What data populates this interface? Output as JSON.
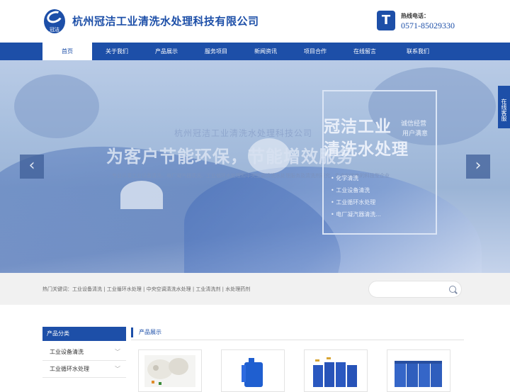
{
  "header": {
    "logo_text": "冠洁",
    "company_name": "杭州冠洁工业清洗水处理科技有限公司",
    "phone_icon": "T",
    "phone_label": "热线电话：",
    "phone_number": "0571-85029330"
  },
  "nav": {
    "items": [
      "首页",
      "关于我们",
      "产品展示",
      "服务项目",
      "新闻资讯",
      "项目合作",
      "在线留言",
      "联系我们"
    ],
    "active_index": 0
  },
  "hero": {
    "subtitle": "杭州冠洁工业清洗水处理科技公司",
    "title": "为客户节能环保，节能增效服务",
    "description": "专业从事工业设备清洗、电厂凝汽器清洗、工业循环水处理和中央空调清洗水处理服务及清洗剂研究、生产和销售的科技型企业",
    "box_title_line1": "冠洁工业",
    "box_title_line2": "清洗水处理",
    "box_side_line1": "诚信经营",
    "box_side_line2": "用户满意",
    "list": [
      "化学清洗",
      "工业设备清洗",
      "工业循环水处理",
      "电厂凝汽器清洗..."
    ],
    "prev_arrow": "‹",
    "next_arrow": "›"
  },
  "float_tab": {
    "label": "在线客服"
  },
  "keywords": {
    "text": "热门关键词：工业设备清洗 | 工业循环水处理 | 中央空调清洗水处理 | 工业清洗剂 | 水处理药剂"
  },
  "search": {
    "placeholder": ""
  },
  "sidebar": {
    "title": "产品分类",
    "items": [
      "工业设备清洗",
      "工业循环水处理"
    ]
  },
  "products": {
    "title": "产品展示"
  },
  "colors": {
    "brand": "#1d4fa8",
    "nav": "#1d4fa8",
    "keyword_bar": "#f1f1f1"
  }
}
